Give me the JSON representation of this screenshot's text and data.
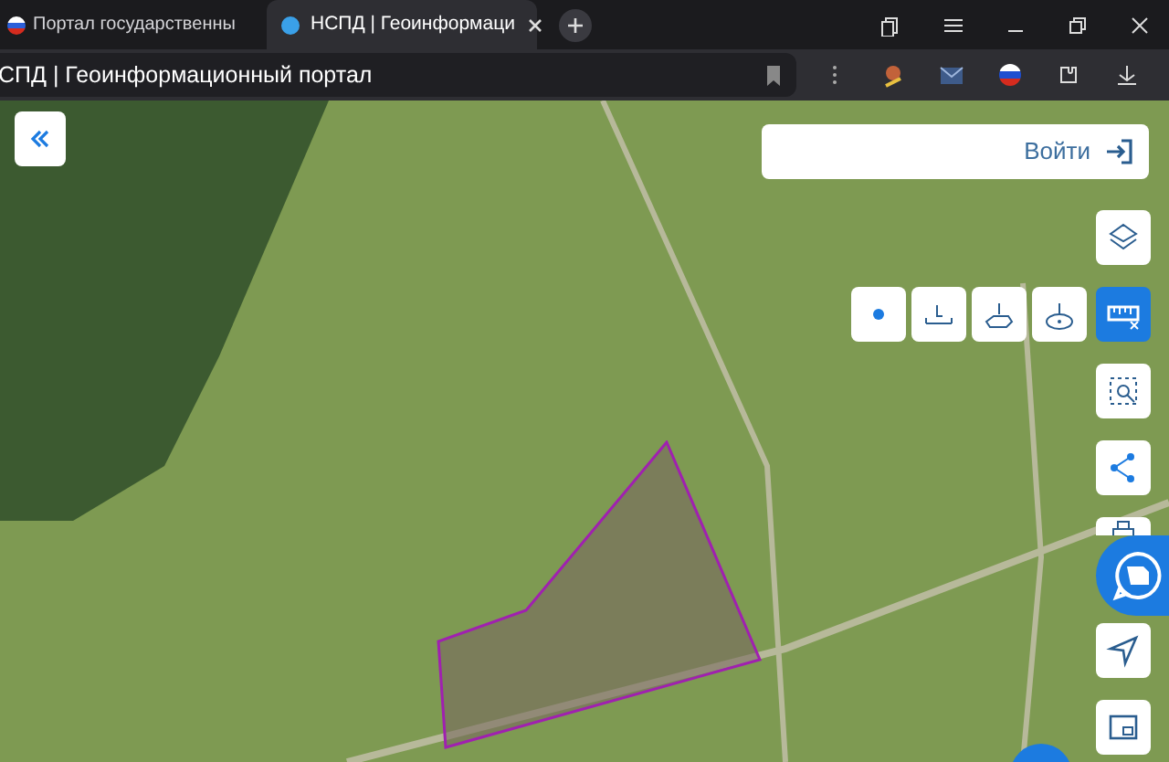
{
  "browser": {
    "tabs": [
      {
        "title": "Портал государственны",
        "selected": false
      },
      {
        "title": "НСПД | Геоинформаци",
        "selected": true
      }
    ],
    "address": "СПД | Геоинформационный портал"
  },
  "map": {
    "login_button": "Войти",
    "measure_tools": [
      {
        "kind": "point",
        "active": false
      },
      {
        "kind": "line",
        "active": false
      },
      {
        "kind": "area",
        "active": false
      },
      {
        "kind": "ellipse",
        "active": false
      }
    ],
    "side_tools": [
      {
        "kind": "layers",
        "active": false
      },
      {
        "kind": "ruler",
        "active": true
      },
      {
        "kind": "select",
        "active": false
      },
      {
        "kind": "share",
        "active": false
      },
      {
        "kind": "print",
        "active": false
      },
      {
        "kind": "locate",
        "active": false
      },
      {
        "kind": "window",
        "active": false
      }
    ]
  }
}
